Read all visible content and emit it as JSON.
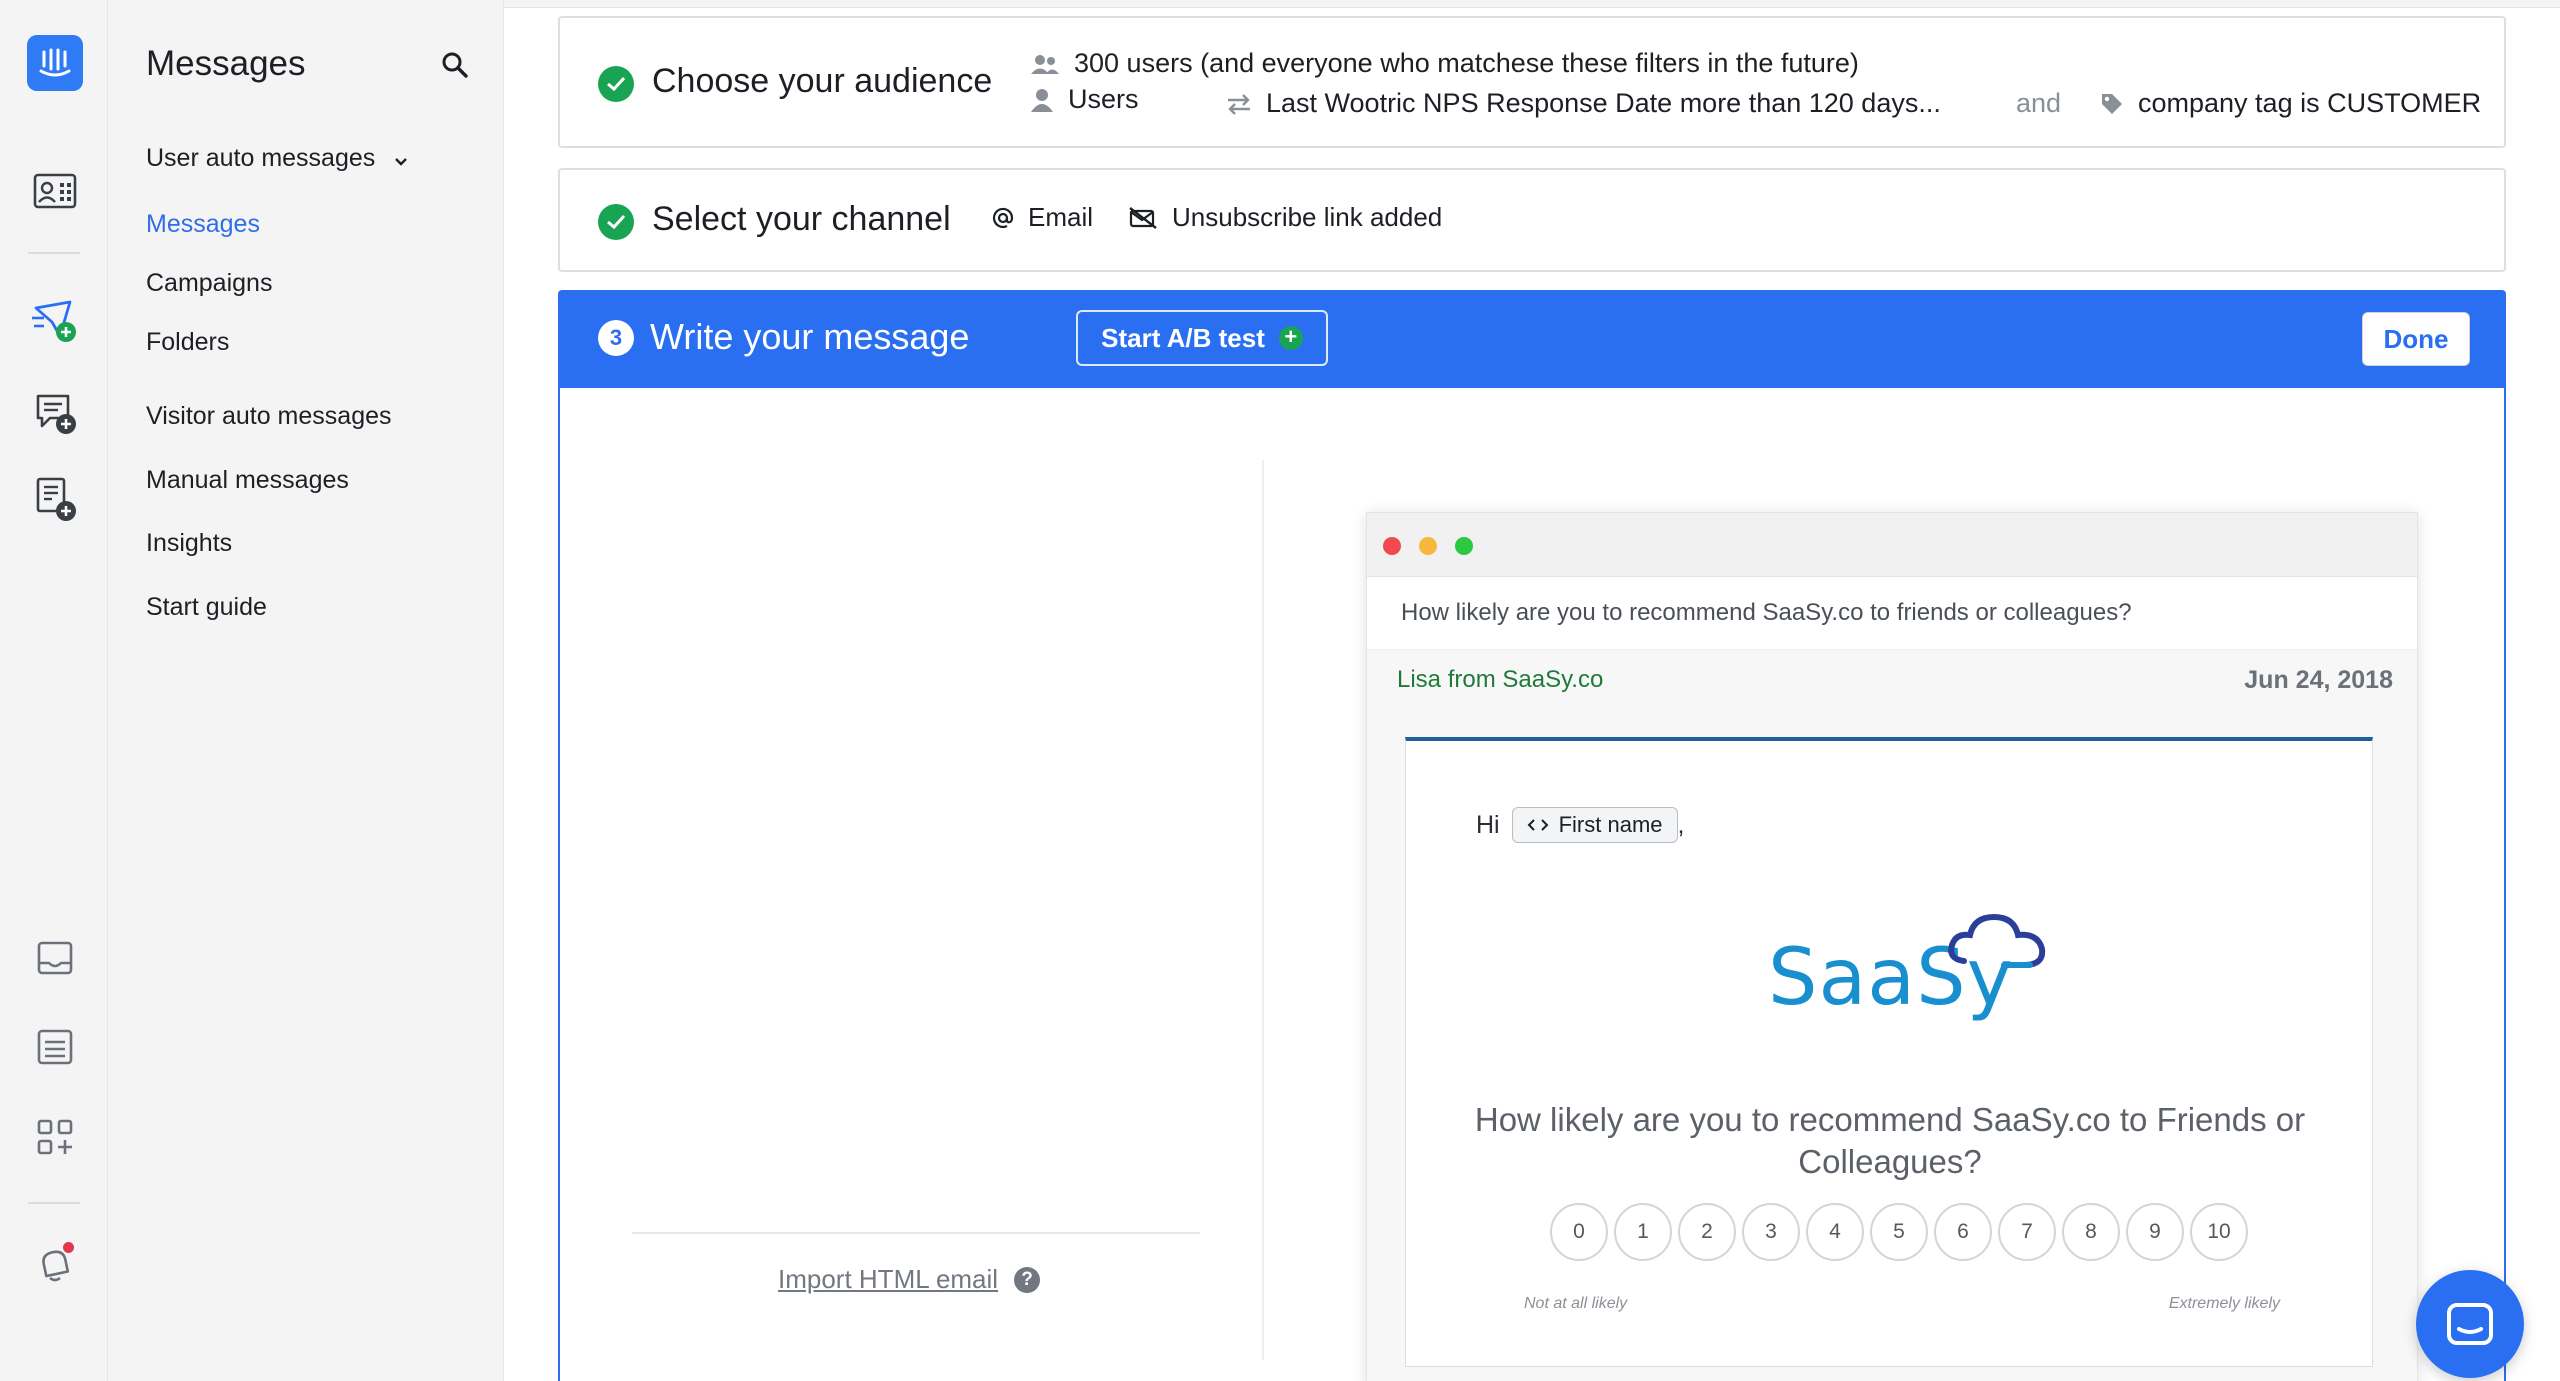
{
  "rail": {
    "icons": [
      "intercom-logo-icon",
      "contacts-icon",
      "outbound-messages-icon",
      "chat-add-icon",
      "article-add-icon",
      "inbox-icon",
      "reports-icon",
      "app-store-icon",
      "notifications-icon"
    ]
  },
  "subnav": {
    "title": "Messages",
    "items": [
      {
        "label": "User auto messages"
      },
      {
        "label": "Messages"
      },
      {
        "label": "Campaigns"
      },
      {
        "label": "Folders"
      },
      {
        "label": "Visitor auto messages"
      },
      {
        "label": "Manual messages"
      },
      {
        "label": "Insights"
      },
      {
        "label": "Start guide"
      }
    ]
  },
  "step1": {
    "title": "Choose your audience",
    "audience_count": "300 users (and everyone who matchese these filters in the future)",
    "user_type": "Users",
    "filter1": "Last Wootric NPS Response Date more than 120 days...",
    "joiner": "and",
    "filter2": "company tag is CUSTOMER"
  },
  "step2": {
    "title": "Select your channel",
    "channel": "Email",
    "unsubscribe": "Unsubscribe link added"
  },
  "step3": {
    "number": "3",
    "title": "Write your message",
    "ab_label": "Start A/B test",
    "ab_plus": "+",
    "done_label": "Done"
  },
  "editor": {
    "import_label": "Import HTML email",
    "help_mark": "?"
  },
  "preview": {
    "subject": "How likely are you to recommend SaaSy.co to friends or colleagues?",
    "from": "Lisa from SaaSy.co",
    "date": "Jun 24, 2018",
    "greeting": "Hi",
    "token_label": "First name",
    "greeting_suffix": ",",
    "brand": "SaaSy",
    "question": "How likely are you to recommend SaaSy.co to Friends or Colleagues?",
    "scale": [
      "0",
      "1",
      "2",
      "3",
      "4",
      "5",
      "6",
      "7",
      "8",
      "9",
      "10"
    ],
    "scale_low": "Not at all likely",
    "scale_high": "Extremely likely"
  },
  "colors": {
    "accent": "#2a6ff2",
    "success": "#19a454",
    "brand_saasy": "#1a8fd0"
  }
}
